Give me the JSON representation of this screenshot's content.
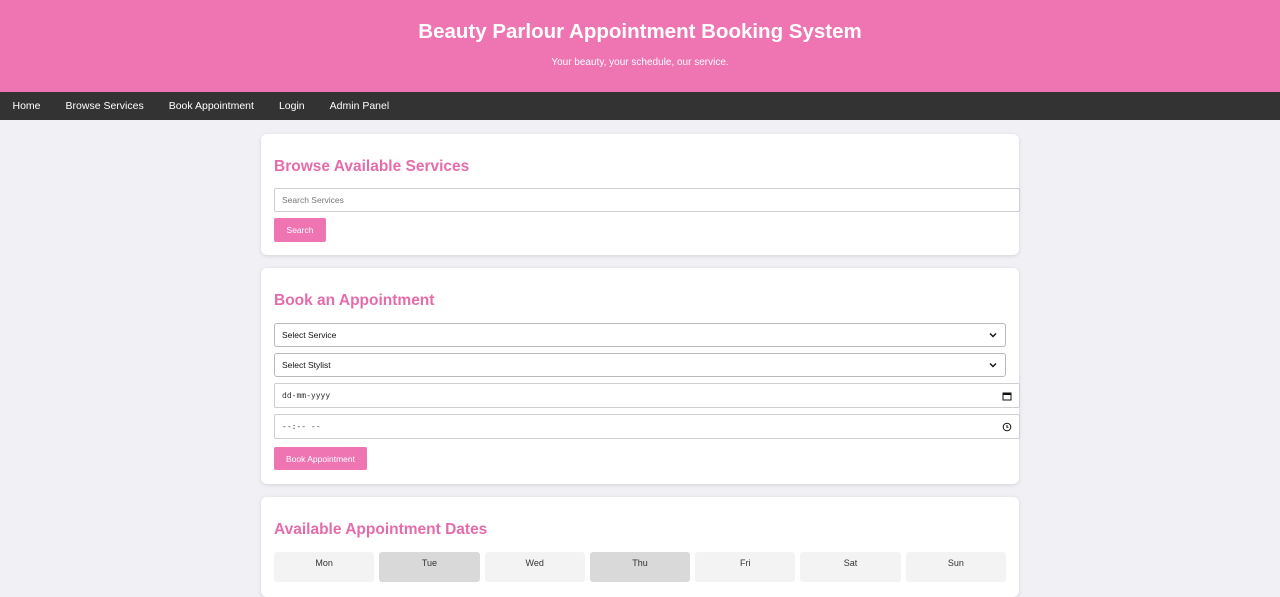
{
  "header": {
    "title": "Beauty Parlour Appointment Booking System",
    "tagline": "Your beauty, your schedule, our service."
  },
  "nav": {
    "items": [
      "Home",
      "Browse Services",
      "Book Appointment",
      "Login",
      "Admin Panel"
    ]
  },
  "browse": {
    "heading": "Browse Available Services",
    "search_placeholder": "Search Services",
    "search_button": "Search"
  },
  "booking": {
    "heading": "Book an Appointment",
    "service_select": "Select Service",
    "stylist_select": "Select Stylist",
    "date_placeholder": "dd-mm-yyyy",
    "time_placeholder": "--:-- --",
    "submit_button": "Book Appointment"
  },
  "dates": {
    "heading": "Available Appointment Dates",
    "days": [
      "Mon",
      "Tue",
      "Wed",
      "Thu",
      "Fri",
      "Sat",
      "Sun"
    ]
  },
  "colors": {
    "accent": "#ee74b2",
    "heading": "#e56cab",
    "navbar": "#333333",
    "background": "#f1f1f5"
  },
  "icons": {
    "select_arrow": "chevron-down-icon",
    "date_picker": "calendar-icon",
    "time_picker": "clock-icon"
  }
}
